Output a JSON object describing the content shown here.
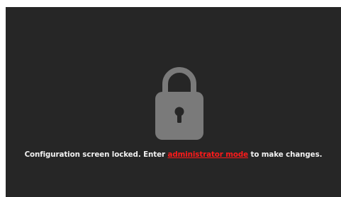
{
  "lock_screen": {
    "icon": "padlock-icon",
    "message_before": "Configuration screen locked. Enter ",
    "link_text": "administrator mode",
    "message_after": " to make changes.",
    "colors": {
      "background": "#262626",
      "icon": "#7a7a7a",
      "text": "#f2f2f2",
      "link": "#ff1a1a"
    }
  }
}
